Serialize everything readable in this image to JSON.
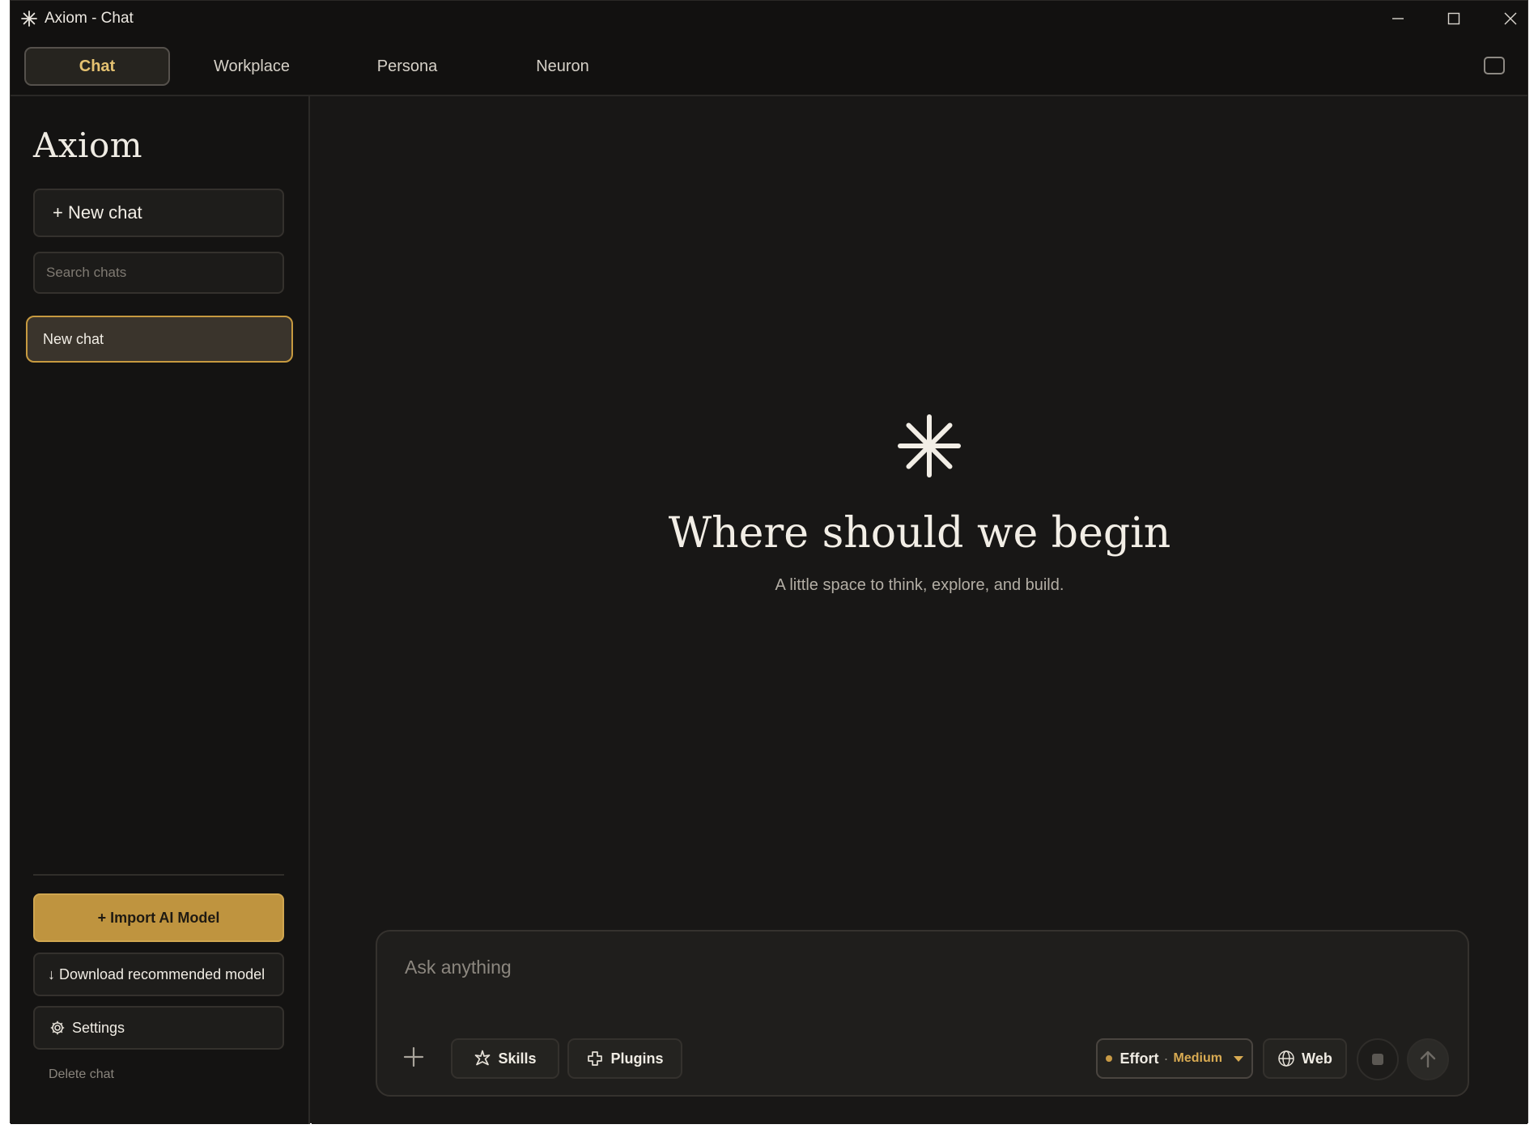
{
  "window": {
    "title": "Axiom - Chat"
  },
  "tabs": [
    {
      "label": "Chat",
      "active": true
    },
    {
      "label": "Workplace",
      "active": false
    },
    {
      "label": "Persona",
      "active": false
    },
    {
      "label": "Neuron",
      "active": false
    }
  ],
  "sidebar": {
    "brand": "Axiom",
    "new_chat_label": "+ New chat",
    "search_placeholder": "Search chats",
    "chats": [
      {
        "label": "New chat",
        "selected": true
      }
    ],
    "import_label": "+ Import AI Model",
    "download_label": "↓ Download recommended model",
    "settings_label": "Settings",
    "delete_label": "Delete chat"
  },
  "main": {
    "title": "Where should we begin",
    "subtitle": "A little space to think, explore, and build."
  },
  "composer": {
    "placeholder": "Ask anything",
    "skills_label": "Skills",
    "plugins_label": "Plugins",
    "effort_label": "Effort",
    "effort_separator": "·",
    "effort_value": "Medium",
    "web_label": "Web"
  },
  "colors": {
    "accent": "#c89a45",
    "background": "#181716",
    "sidebar": "#141312",
    "selected_border": "#c79a40"
  },
  "icons": {
    "app": "asterisk-icon",
    "minimize": "minimize-icon",
    "maximize": "maximize-icon",
    "close": "close-icon",
    "layout": "panel-toggle-icon",
    "settings": "gear-icon",
    "skills": "sparkle-icon",
    "plugins": "puzzle-icon",
    "web": "globe-icon",
    "stop": "stop-icon",
    "send": "arrow-up-icon"
  }
}
